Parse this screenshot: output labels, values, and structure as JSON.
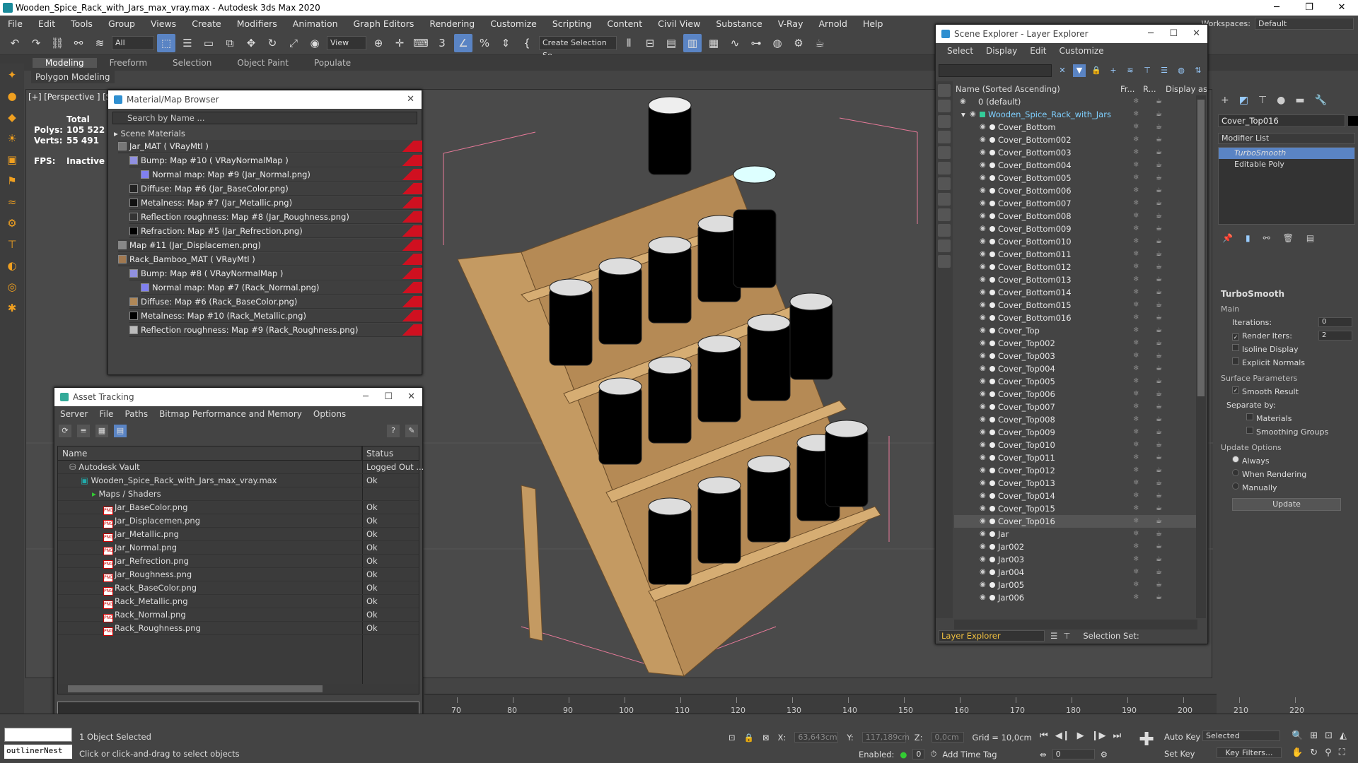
{
  "window": {
    "title": "Wooden_Spice_Rack_with_Jars_max_vray.max - Autodesk 3ds Max 2020"
  },
  "menu": [
    "File",
    "Edit",
    "Tools",
    "Group",
    "Views",
    "Create",
    "Modifiers",
    "Animation",
    "Graph Editors",
    "Rendering",
    "Customize",
    "Scripting",
    "Content",
    "Civil View",
    "Substance",
    "V-Ray",
    "Arnold",
    "Help"
  ],
  "workspaces": {
    "label": "Workspaces:",
    "value": "Default"
  },
  "toolbar": {
    "filter": "All",
    "refcoord": "View",
    "selection_set": "Create Selection Se"
  },
  "ribbon": {
    "tabs": [
      "Modeling",
      "Freeform",
      "Selection",
      "Object Paint",
      "Populate"
    ],
    "sub": "Polygon Modeling"
  },
  "viewport": {
    "label": "[+] [Perspective ] [St",
    "stats": {
      "total_label": "Total",
      "polys_label": "Polys:",
      "polys": "105 522",
      "verts_label": "Verts:",
      "verts": "55 491",
      "fps_label": "FPS:",
      "fps": "Inactive"
    }
  },
  "material_browser": {
    "title": "Material/Map Browser",
    "search_placeholder": "Search by Name ...",
    "section": "Scene Materials",
    "rows": [
      {
        "label": "Jar_MAT  ( VRayMtl )",
        "indent": 0,
        "swatch": "#777777"
      },
      {
        "label": "Bump: Map #10  ( VRayNormalMap )",
        "indent": 1,
        "swatch": "#9090e0"
      },
      {
        "label": "Normal map: Map #9 (Jar_Normal.png)",
        "indent": 2,
        "swatch": "#8080f0"
      },
      {
        "label": "Diffuse: Map #6 (Jar_BaseColor.png)",
        "indent": 1,
        "swatch": "#222222"
      },
      {
        "label": "Metalness: Map #7 (Jar_Metallic.png)",
        "indent": 1,
        "swatch": "#111111"
      },
      {
        "label": "Reflection roughness: Map #8 (Jar_Roughness.png)",
        "indent": 1,
        "swatch": "#333333"
      },
      {
        "label": "Refraction: Map #5 (Jar_Refrection.png)",
        "indent": 1,
        "swatch": "#000000"
      },
      {
        "label": "Map #11 (Jar_Displacemen.png)",
        "indent": 0,
        "swatch": "#888888"
      },
      {
        "label": "Rack_Bamboo_MAT  ( VRayMtl )",
        "indent": 0,
        "swatch": "#a07850"
      },
      {
        "label": "Bump: Map #8  ( VRayNormalMap )",
        "indent": 1,
        "swatch": "#9090e0"
      },
      {
        "label": "Normal map: Map #7 (Rack_Normal.png)",
        "indent": 2,
        "swatch": "#8080f0"
      },
      {
        "label": "Diffuse: Map #6 (Rack_BaseColor.png)",
        "indent": 1,
        "swatch": "#b08858"
      },
      {
        "label": "Metalness: Map #10 (Rack_Metallic.png)",
        "indent": 1,
        "swatch": "#000000"
      },
      {
        "label": "Reflection roughness: Map #9 (Rack_Roughness.png)",
        "indent": 1,
        "swatch": "#bbbbbb"
      }
    ]
  },
  "asset_tracking": {
    "title": "Asset Tracking",
    "menu": [
      "Server",
      "File",
      "Paths",
      "Bitmap Performance and Memory",
      "Options"
    ],
    "col_name": "Name",
    "col_status": "Status",
    "rows": [
      {
        "name": "Autodesk Vault",
        "status": "Logged Out ...",
        "indent": 1,
        "kind": "vault"
      },
      {
        "name": "Wooden_Spice_Rack_with_Jars_max_vray.max",
        "status": "Ok",
        "indent": 2,
        "kind": "max"
      },
      {
        "name": "Maps / Shaders",
        "status": "",
        "indent": 3,
        "kind": "folder"
      },
      {
        "name": "Jar_BaseColor.png",
        "status": "Ok",
        "indent": 4,
        "kind": "png"
      },
      {
        "name": "Jar_Displacemen.png",
        "status": "Ok",
        "indent": 4,
        "kind": "png"
      },
      {
        "name": "Jar_Metallic.png",
        "status": "Ok",
        "indent": 4,
        "kind": "png"
      },
      {
        "name": "Jar_Normal.png",
        "status": "Ok",
        "indent": 4,
        "kind": "png"
      },
      {
        "name": "Jar_Refrection.png",
        "status": "Ok",
        "indent": 4,
        "kind": "png"
      },
      {
        "name": "Jar_Roughness.png",
        "status": "Ok",
        "indent": 4,
        "kind": "png"
      },
      {
        "name": "Rack_BaseColor.png",
        "status": "Ok",
        "indent": 4,
        "kind": "png"
      },
      {
        "name": "Rack_Metallic.png",
        "status": "Ok",
        "indent": 4,
        "kind": "png"
      },
      {
        "name": "Rack_Normal.png",
        "status": "Ok",
        "indent": 4,
        "kind": "png"
      },
      {
        "name": "Rack_Roughness.png",
        "status": "Ok",
        "indent": 4,
        "kind": "png"
      }
    ]
  },
  "scene_explorer": {
    "title": "Scene Explorer - Layer Explorer",
    "menu": [
      "Select",
      "Display",
      "Edit",
      "Customize"
    ],
    "col_name": "Name (Sorted Ascending)",
    "col_fr": "Fr...",
    "col_r": "R...",
    "col_disp": "Display as E",
    "rows": [
      {
        "name": "0 (default)",
        "indent": 0,
        "kind": "layer"
      },
      {
        "name": "Wooden_Spice_Rack_with_Jars",
        "indent": 1,
        "kind": "group",
        "hl": true
      },
      {
        "name": "Cover_Bottom",
        "indent": 2
      },
      {
        "name": "Cover_Bottom002",
        "indent": 2
      },
      {
        "name": "Cover_Bottom003",
        "indent": 2
      },
      {
        "name": "Cover_Bottom004",
        "indent": 2
      },
      {
        "name": "Cover_Bottom005",
        "indent": 2
      },
      {
        "name": "Cover_Bottom006",
        "indent": 2
      },
      {
        "name": "Cover_Bottom007",
        "indent": 2
      },
      {
        "name": "Cover_Bottom008",
        "indent": 2
      },
      {
        "name": "Cover_Bottom009",
        "indent": 2
      },
      {
        "name": "Cover_Bottom010",
        "indent": 2
      },
      {
        "name": "Cover_Bottom011",
        "indent": 2
      },
      {
        "name": "Cover_Bottom012",
        "indent": 2
      },
      {
        "name": "Cover_Bottom013",
        "indent": 2
      },
      {
        "name": "Cover_Bottom014",
        "indent": 2
      },
      {
        "name": "Cover_Bottom015",
        "indent": 2
      },
      {
        "name": "Cover_Bottom016",
        "indent": 2
      },
      {
        "name": "Cover_Top",
        "indent": 2
      },
      {
        "name": "Cover_Top002",
        "indent": 2
      },
      {
        "name": "Cover_Top003",
        "indent": 2
      },
      {
        "name": "Cover_Top004",
        "indent": 2
      },
      {
        "name": "Cover_Top005",
        "indent": 2
      },
      {
        "name": "Cover_Top006",
        "indent": 2
      },
      {
        "name": "Cover_Top007",
        "indent": 2
      },
      {
        "name": "Cover_Top008",
        "indent": 2
      },
      {
        "name": "Cover_Top009",
        "indent": 2
      },
      {
        "name": "Cover_Top010",
        "indent": 2
      },
      {
        "name": "Cover_Top011",
        "indent": 2
      },
      {
        "name": "Cover_Top012",
        "indent": 2
      },
      {
        "name": "Cover_Top013",
        "indent": 2
      },
      {
        "name": "Cover_Top014",
        "indent": 2
      },
      {
        "name": "Cover_Top015",
        "indent": 2
      },
      {
        "name": "Cover_Top016",
        "indent": 2,
        "selected": true
      },
      {
        "name": "Jar",
        "indent": 2
      },
      {
        "name": "Jar002",
        "indent": 2
      },
      {
        "name": "Jar003",
        "indent": 2
      },
      {
        "name": "Jar004",
        "indent": 2
      },
      {
        "name": "Jar005",
        "indent": 2
      },
      {
        "name": "Jar006",
        "indent": 2
      }
    ],
    "footer_explorer": "Layer Explorer",
    "footer_selset": "Selection Set:"
  },
  "command_panel": {
    "object_name": "Cover_Top016",
    "object_color": "#000000",
    "modifier_list": "Modifier List",
    "stack": [
      "TurboSmooth",
      "Editable Poly"
    ],
    "rollout": {
      "title": "TurboSmooth",
      "main": "Main",
      "iterations_label": "Iterations:",
      "iterations": "0",
      "render_iters_label": "Render Iters:",
      "render_iters": "2",
      "isoline": "Isoline Display",
      "explicit": "Explicit Normals",
      "surface": "Surface Parameters",
      "smooth_result": "Smooth Result",
      "separate_by": "Separate by:",
      "materials": "Materials",
      "smoothing_groups": "Smoothing Groups",
      "update_options": "Update Options",
      "always": "Always",
      "when_rendering": "When Rendering",
      "manually": "Manually",
      "update_btn": "Update"
    }
  },
  "timeline": {
    "ticks": [
      "70",
      "80",
      "90",
      "100",
      "110",
      "120",
      "130",
      "140",
      "150",
      "160",
      "170",
      "180",
      "190",
      "200",
      "210",
      "220"
    ]
  },
  "status": {
    "selected": "1 Object Selected",
    "hint": "Click or click-and-drag to select objects",
    "script": "outlinerNest",
    "x_label": "X:",
    "x": "63,643cm",
    "y_label": "Y:",
    "y": "117,189cm",
    "z_label": "Z:",
    "z": "0,0cm",
    "grid": "Grid = 10,0cm",
    "enabled": "Enabled:",
    "enabled_val": "0",
    "add_time_tag": "Add Time Tag",
    "frame": "0",
    "auto_key": "Auto Key",
    "set_key": "Set Key",
    "selected_dd": "Selected",
    "key_filters": "Key Filters..."
  }
}
